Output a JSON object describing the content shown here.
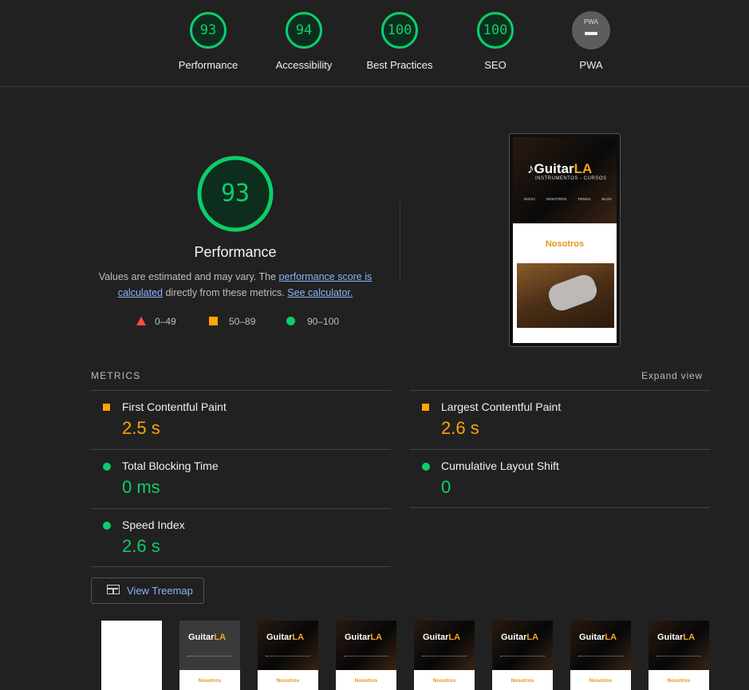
{
  "categories": [
    {
      "label": "Performance",
      "score": "93"
    },
    {
      "label": "Accessibility",
      "score": "94"
    },
    {
      "label": "Best Practices",
      "score": "100"
    },
    {
      "label": "SEO",
      "score": "100"
    },
    {
      "label": "PWA",
      "badge": "PWA"
    }
  ],
  "main": {
    "score": "93",
    "title": "Performance",
    "desc_prefix": "Values are estimated and may vary. The ",
    "desc_link1": "performance score is calculated",
    "desc_middle": " directly from these metrics. ",
    "desc_link2": "See calculator.",
    "legend": {
      "fail": "0–49",
      "average": "50–89",
      "pass": "90–100"
    }
  },
  "screenshot": {
    "logo_main": "Guitar",
    "logo_accent": "LA",
    "tagline": "INSTRUMENTOS - CURSOS",
    "nav": [
      "INICIO",
      "NOSOTROS",
      "TIENDA",
      "BLOG"
    ],
    "section_title": "Nosotros"
  },
  "metrics": {
    "heading": "METRICS",
    "expand": "Expand view",
    "items": [
      {
        "title": "First Contentful Paint",
        "value": "2.5 s",
        "status": "average"
      },
      {
        "title": "Largest Contentful Paint",
        "value": "2.6 s",
        "status": "average"
      },
      {
        "title": "Total Blocking Time",
        "value": "0 ms",
        "status": "pass"
      },
      {
        "title": "Cumulative Layout Shift",
        "value": "0",
        "status": "pass"
      },
      {
        "title": "Speed Index",
        "value": "2.6 s",
        "status": "pass"
      }
    ]
  },
  "treemap_button": "View Treemap",
  "filmstrip": {
    "logo_main": "Guitar",
    "logo_accent": "LA",
    "section": "Nosotros"
  },
  "colors": {
    "pass": "#0cce6b",
    "average": "#ffa400",
    "fail": "#ff4e42",
    "link": "#8ab4f8",
    "background": "#212121"
  }
}
